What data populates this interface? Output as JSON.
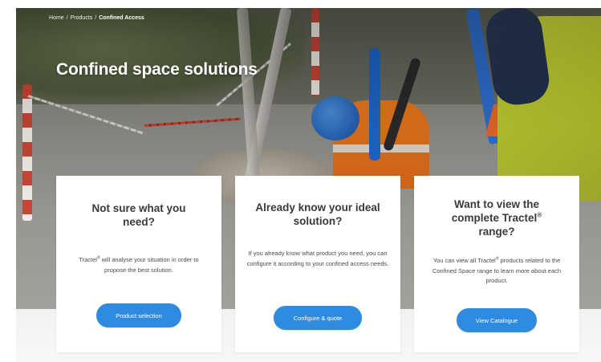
{
  "breadcrumb": {
    "items": [
      "Home",
      "Products",
      "Confined Access"
    ],
    "separator": "/"
  },
  "hero": {
    "title": "Confined space solutions"
  },
  "cards": [
    {
      "heading": "Not sure what you need?",
      "body_prefix": "Tractel",
      "body_sup": "®",
      "body_suffix": " will analyse your situation in order to propose the best solution.",
      "button_label": "Product selection"
    },
    {
      "heading": "Already know your ideal solution?",
      "body": "If you already know what product you need, you can configure it according to your confined access needs.",
      "button_label": "Configure & quote"
    },
    {
      "heading_prefix": "Want to view the complete Tractel",
      "heading_sup": "®",
      "heading_suffix": " range?",
      "body_prefix": "You can view all Tractel",
      "body_sup": "®",
      "body_suffix": " products related to the Confined Space range to learn more about each product.",
      "button_label": "View Catalogue"
    }
  ],
  "colors": {
    "accent": "#2f8be0",
    "hero_text": "#ffffff",
    "heading_text": "#3a3a3a",
    "body_text": "#4a4a4a",
    "background": "#ffffff"
  }
}
